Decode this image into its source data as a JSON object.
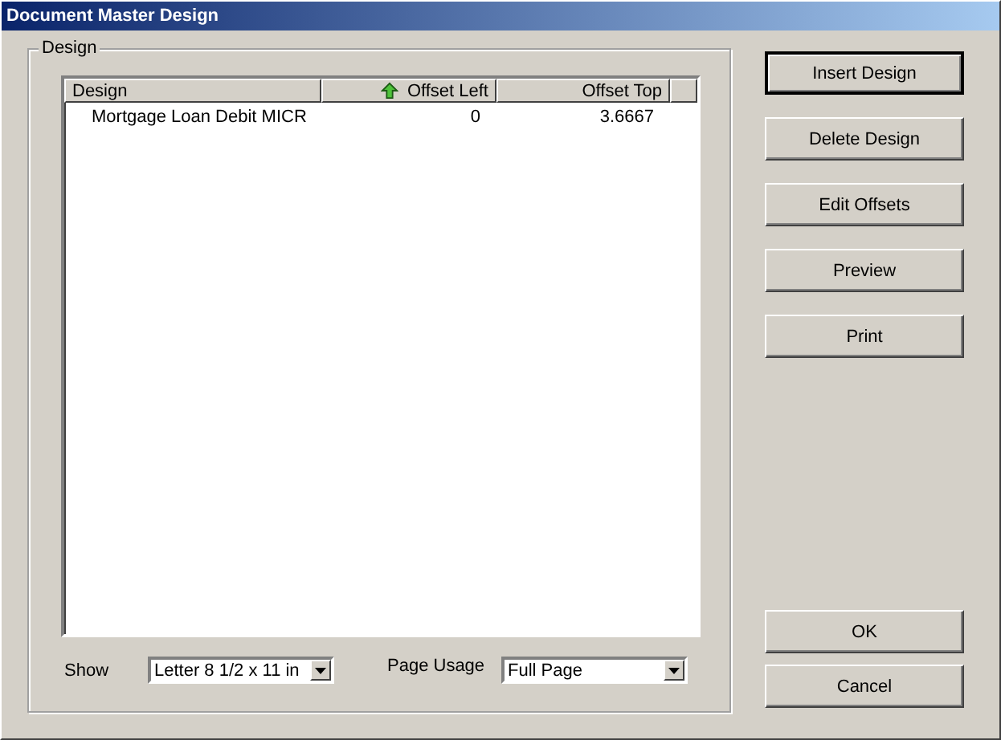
{
  "window": {
    "title": "Document Master Design"
  },
  "group": {
    "label": "Design"
  },
  "table": {
    "columns": [
      {
        "label": "Design",
        "sorted": false
      },
      {
        "label": "Offset Left",
        "sorted": true
      },
      {
        "label": "Offset Top",
        "sorted": false
      }
    ],
    "rows": [
      [
        "Mortgage Loan Debit MICR",
        "0",
        "3.6667"
      ]
    ]
  },
  "show": {
    "label": "Show",
    "value": "Letter 8 1/2 x 11 in"
  },
  "page_usage": {
    "label": "Page Usage",
    "value": "Full Page"
  },
  "buttons": [
    {
      "label": "Insert Design",
      "default": true
    },
    {
      "label": "Delete Design",
      "default": false
    },
    {
      "label": "Edit Offsets",
      "default": false
    },
    {
      "label": "Preview",
      "default": false
    },
    {
      "label": "Print",
      "default": false
    }
  ],
  "dialog_buttons": [
    {
      "label": "OK",
      "default": false
    },
    {
      "label": "Cancel",
      "default": false
    }
  ]
}
